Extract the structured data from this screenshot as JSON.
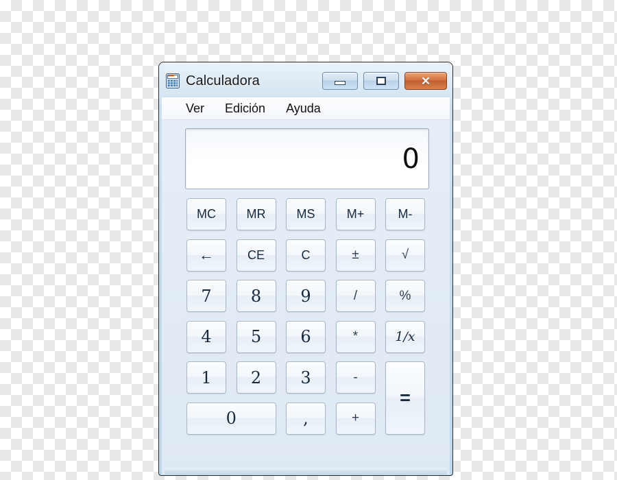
{
  "window": {
    "title": "Calculadora",
    "icon": "calculator-icon",
    "controls": {
      "minimize": "—",
      "restore": "❐",
      "close": "✕"
    }
  },
  "menubar": {
    "items": [
      {
        "label": "Ver"
      },
      {
        "label": "Edición"
      },
      {
        "label": "Ayuda"
      }
    ]
  },
  "display": {
    "value": "0"
  },
  "keypad": {
    "rows": [
      [
        {
          "label": "MC",
          "name": "key-memory-clear",
          "kind": "small"
        },
        {
          "label": "MR",
          "name": "key-memory-recall",
          "kind": "small"
        },
        {
          "label": "MS",
          "name": "key-memory-store",
          "kind": "small"
        },
        {
          "label": "M+",
          "name": "key-memory-add",
          "kind": "small"
        },
        {
          "label": "M-",
          "name": "key-memory-subtract",
          "kind": "small"
        }
      ],
      [
        {
          "label": "←",
          "name": "key-backspace",
          "kind": "arrow"
        },
        {
          "label": "CE",
          "name": "key-clear-entry",
          "kind": "small"
        },
        {
          "label": "C",
          "name": "key-clear",
          "kind": "small"
        },
        {
          "label": "±",
          "name": "key-sign-toggle",
          "kind": "op"
        },
        {
          "label": "√",
          "name": "key-square-root",
          "kind": "op"
        }
      ],
      [
        {
          "label": "7",
          "name": "key-7",
          "kind": "num"
        },
        {
          "label": "8",
          "name": "key-8",
          "kind": "num"
        },
        {
          "label": "9",
          "name": "key-9",
          "kind": "num"
        },
        {
          "label": "/",
          "name": "key-divide",
          "kind": "op"
        },
        {
          "label": "%",
          "name": "key-percent",
          "kind": "op"
        }
      ],
      [
        {
          "label": "4",
          "name": "key-4",
          "kind": "num"
        },
        {
          "label": "5",
          "name": "key-5",
          "kind": "num"
        },
        {
          "label": "6",
          "name": "key-6",
          "kind": "num"
        },
        {
          "label": "*",
          "name": "key-multiply",
          "kind": "op"
        },
        {
          "label": "1/x",
          "name": "key-reciprocal",
          "kind": "ital"
        }
      ],
      [
        {
          "label": "1",
          "name": "key-1",
          "kind": "num"
        },
        {
          "label": "2",
          "name": "key-2",
          "kind": "num"
        },
        {
          "label": "3",
          "name": "key-3",
          "kind": "num"
        },
        {
          "label": "-",
          "name": "key-subtract",
          "kind": "op"
        },
        {
          "label": "=",
          "name": "key-equals",
          "kind": "equals"
        }
      ],
      [
        {
          "label": "0",
          "name": "key-0",
          "kind": "num"
        },
        {
          "label": ",",
          "name": "key-decimal-comma",
          "kind": "num"
        },
        {
          "label": "+",
          "name": "key-add",
          "kind": "op"
        }
      ]
    ]
  },
  "colors": {
    "titlebar": "#c6dcee",
    "close_button": "#c05f2d",
    "window_border": "#2b2b2b",
    "key_face": "#f3f7fb",
    "display_bg": "#ffffff",
    "text": "#16293d"
  }
}
